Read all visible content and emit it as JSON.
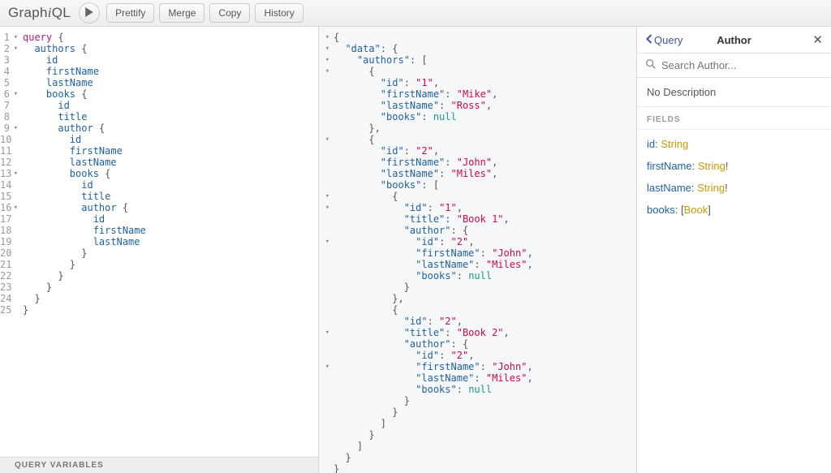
{
  "logo_text": "GraphiQL",
  "toolbar": {
    "prettify": "Prettify",
    "merge": "Merge",
    "copy": "Copy",
    "history": "History"
  },
  "editor": {
    "line_count": 25,
    "fold_lines": [
      1,
      2,
      6,
      9,
      13,
      16
    ],
    "lines": [
      {
        "t": [
          "kw:query",
          " ",
          "punc:{"
        ],
        "ind": 0
      },
      {
        "t": [
          "attr:authors",
          " ",
          "punc:{"
        ],
        "ind": 1
      },
      {
        "t": [
          "attr:id"
        ],
        "ind": 2
      },
      {
        "t": [
          "attr:firstName"
        ],
        "ind": 2
      },
      {
        "t": [
          "attr:lastName"
        ],
        "ind": 2
      },
      {
        "t": [
          "attr:books",
          " ",
          "punc:{"
        ],
        "ind": 2
      },
      {
        "t": [
          "attr:id"
        ],
        "ind": 3
      },
      {
        "t": [
          "attr:title"
        ],
        "ind": 3
      },
      {
        "t": [
          "attr:author",
          " ",
          "punc:{"
        ],
        "ind": 3
      },
      {
        "t": [
          "attr:id"
        ],
        "ind": 4
      },
      {
        "t": [
          "attr:firstName"
        ],
        "ind": 4
      },
      {
        "t": [
          "attr:lastName"
        ],
        "ind": 4
      },
      {
        "t": [
          "attr:books",
          " ",
          "punc:{"
        ],
        "ind": 4
      },
      {
        "t": [
          "attr:id"
        ],
        "ind": 5
      },
      {
        "t": [
          "attr:title"
        ],
        "ind": 5
      },
      {
        "t": [
          "attr:author",
          " ",
          "punc:{"
        ],
        "ind": 5
      },
      {
        "t": [
          "attr:id"
        ],
        "ind": 6
      },
      {
        "t": [
          "attr:firstName"
        ],
        "ind": 6
      },
      {
        "t": [
          "attr:lastName"
        ],
        "ind": 6
      },
      {
        "t": [
          "punc:}"
        ],
        "ind": 5
      },
      {
        "t": [
          "punc:}"
        ],
        "ind": 4
      },
      {
        "t": [
          "punc:}"
        ],
        "ind": 3
      },
      {
        "t": [
          "punc:}"
        ],
        "ind": 2
      },
      {
        "t": [
          "punc:}"
        ],
        "ind": 1
      },
      {
        "t": [
          "punc:}"
        ],
        "ind": 0
      }
    ],
    "qv_label": "QUERY VARIABLES"
  },
  "result": {
    "fold_lines": [
      1,
      2,
      3,
      4,
      10,
      15,
      16,
      19,
      27,
      30
    ],
    "lines": [
      {
        "ind": 0,
        "t": [
          "jp:{"
        ]
      },
      {
        "ind": 1,
        "t": [
          "jkey:\"data\"",
          "jp:: {"
        ]
      },
      {
        "ind": 2,
        "t": [
          "jkey:\"authors\"",
          "jp:: ["
        ]
      },
      {
        "ind": 3,
        "t": [
          "jp:{"
        ]
      },
      {
        "ind": 4,
        "t": [
          "jkey:\"id\"",
          "jp:: ",
          "jstr:\"1\"",
          "jp:,"
        ]
      },
      {
        "ind": 4,
        "t": [
          "jkey:\"firstName\"",
          "jp:: ",
          "jstr:\"Mike\"",
          "jp:,"
        ]
      },
      {
        "ind": 4,
        "t": [
          "jkey:\"lastName\"",
          "jp:: ",
          "jstr:\"Ross\"",
          "jp:,"
        ]
      },
      {
        "ind": 4,
        "t": [
          "jkey:\"books\"",
          "jp:: ",
          "jkw:null"
        ]
      },
      {
        "ind": 3,
        "t": [
          "jp:},"
        ]
      },
      {
        "ind": 3,
        "t": [
          "jp:{"
        ]
      },
      {
        "ind": 4,
        "t": [
          "jkey:\"id\"",
          "jp:: ",
          "jstr:\"2\"",
          "jp:,"
        ]
      },
      {
        "ind": 4,
        "t": [
          "jkey:\"firstName\"",
          "jp:: ",
          "jstr:\"John\"",
          "jp:,"
        ]
      },
      {
        "ind": 4,
        "t": [
          "jkey:\"lastName\"",
          "jp:: ",
          "jstr:\"Miles\"",
          "jp:,"
        ]
      },
      {
        "ind": 4,
        "t": [
          "jkey:\"books\"",
          "jp:: ["
        ]
      },
      {
        "ind": 5,
        "t": [
          "jp:{"
        ]
      },
      {
        "ind": 6,
        "t": [
          "jkey:\"id\"",
          "jp:: ",
          "jstr:\"1\"",
          "jp:,"
        ]
      },
      {
        "ind": 6,
        "t": [
          "jkey:\"title\"",
          "jp:: ",
          "jstr:\"Book 1\"",
          "jp:,"
        ]
      },
      {
        "ind": 6,
        "t": [
          "jkey:\"author\"",
          "jp:: {"
        ]
      },
      {
        "ind": 7,
        "t": [
          "jkey:\"id\"",
          "jp:: ",
          "jstr:\"2\"",
          "jp:,"
        ]
      },
      {
        "ind": 7,
        "t": [
          "jkey:\"firstName\"",
          "jp:: ",
          "jstr:\"John\"",
          "jp:,"
        ]
      },
      {
        "ind": 7,
        "t": [
          "jkey:\"lastName\"",
          "jp:: ",
          "jstr:\"Miles\"",
          "jp:,"
        ]
      },
      {
        "ind": 7,
        "t": [
          "jkey:\"books\"",
          "jp:: ",
          "jkw:null"
        ]
      },
      {
        "ind": 6,
        "t": [
          "jp:}"
        ]
      },
      {
        "ind": 5,
        "t": [
          "jp:},"
        ]
      },
      {
        "ind": 5,
        "t": [
          "jp:{"
        ]
      },
      {
        "ind": 6,
        "t": [
          "jkey:\"id\"",
          "jp:: ",
          "jstr:\"2\"",
          "jp:,"
        ]
      },
      {
        "ind": 6,
        "t": [
          "jkey:\"title\"",
          "jp:: ",
          "jstr:\"Book 2\"",
          "jp:,"
        ]
      },
      {
        "ind": 6,
        "t": [
          "jkey:\"author\"",
          "jp:: {"
        ]
      },
      {
        "ind": 7,
        "t": [
          "jkey:\"id\"",
          "jp:: ",
          "jstr:\"2\"",
          "jp:,"
        ]
      },
      {
        "ind": 7,
        "t": [
          "jkey:\"firstName\"",
          "jp:: ",
          "jstr:\"John\"",
          "jp:,"
        ]
      },
      {
        "ind": 7,
        "t": [
          "jkey:\"lastName\"",
          "jp:: ",
          "jstr:\"Miles\"",
          "jp:,"
        ]
      },
      {
        "ind": 7,
        "t": [
          "jkey:\"books\"",
          "jp:: ",
          "jkw:null"
        ]
      },
      {
        "ind": 6,
        "t": [
          "jp:}"
        ]
      },
      {
        "ind": 5,
        "t": [
          "jp:}"
        ]
      },
      {
        "ind": 4,
        "t": [
          "jp:]"
        ]
      },
      {
        "ind": 3,
        "t": [
          "jp:}"
        ]
      },
      {
        "ind": 2,
        "t": [
          "jp:]"
        ]
      },
      {
        "ind": 1,
        "t": [
          "jp:}"
        ]
      },
      {
        "ind": 0,
        "t": [
          "jp:}"
        ]
      }
    ]
  },
  "docs": {
    "back_label": "Query",
    "title": "Author",
    "search_placeholder": "Search Author...",
    "description": "No Description",
    "fields_label": "FIELDS",
    "fields": [
      {
        "name": "id",
        "type": "String",
        "nn": false,
        "list": false
      },
      {
        "name": "firstName",
        "type": "String",
        "nn": true,
        "list": false
      },
      {
        "name": "lastName",
        "type": "String",
        "nn": true,
        "list": false
      },
      {
        "name": "books",
        "type": "Book",
        "nn": false,
        "list": true
      }
    ]
  }
}
